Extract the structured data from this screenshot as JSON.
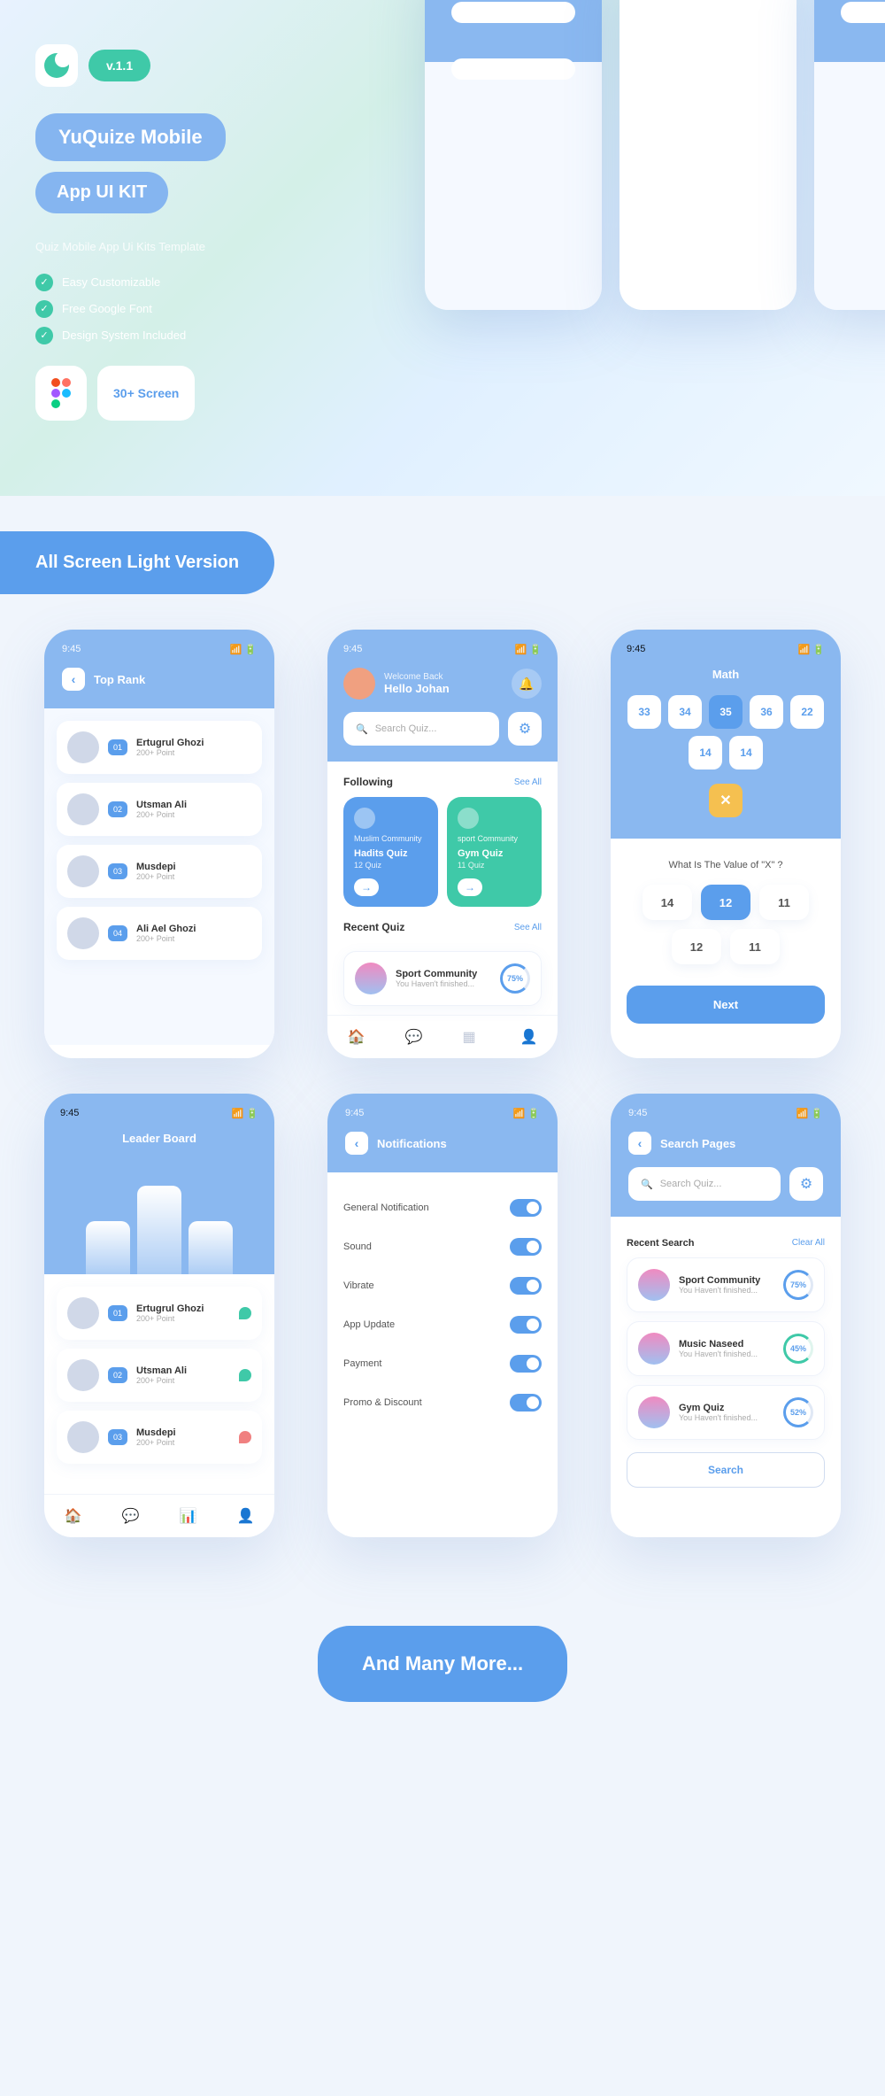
{
  "hero": {
    "version": "v.1.1",
    "title1": "YuQuize  Mobile",
    "title2": "App UI KIT",
    "subtitle": "Quiz  Mobile\nApp Ui Kits Template",
    "features": [
      "Easy Customizable",
      "Free Google Font",
      "Design System Included"
    ],
    "screen_count": "30+ Screen"
  },
  "section_light": "All Screen Light Version",
  "status_time": "9:45",
  "home": {
    "welcome": "Welcome Back",
    "name": "Hello Johan",
    "search_placeholder": "Search Quiz...",
    "following_title": "Following",
    "see_all": "See All",
    "cards": [
      {
        "community": "Muslim Community",
        "title": "Hadits Quiz",
        "sub": "12 Quiz"
      },
      {
        "community": "sport Community",
        "title": "Gym Quiz",
        "sub": "11 Quiz"
      }
    ],
    "recent_title": "Recent Quiz",
    "recent": {
      "title": "Sport Community",
      "sub": "You Haven't finished...",
      "pct": "75%"
    }
  },
  "top_rank": {
    "title": "Top Rank",
    "items": [
      {
        "num": "01",
        "name": "Ertugrul Ghozi",
        "pts": "200+ Point"
      },
      {
        "num": "02",
        "name": "Utsman Ali",
        "pts": "200+ Point"
      },
      {
        "num": "03",
        "name": "Musdepi",
        "pts": "200+ Point"
      },
      {
        "num": "04",
        "name": "Ali Ael Ghozi",
        "pts": "200+ Point"
      }
    ]
  },
  "math": {
    "title": "Math",
    "nums": [
      "33",
      "34",
      "35",
      "36",
      "22",
      "14",
      "14"
    ],
    "active_idx": 2,
    "question": "What Is The Value of \"X\" ?",
    "answers": [
      "14",
      "12",
      "11",
      "12",
      "11"
    ],
    "answer_active": 1,
    "next": "Next"
  },
  "leader": {
    "title": "Leader Board",
    "items": [
      {
        "num": "01",
        "name": "Ertugrul Ghozi",
        "pts": "200+ Point",
        "up": true
      },
      {
        "num": "02",
        "name": "Utsman Ali",
        "pts": "200+ Point",
        "up": true
      },
      {
        "num": "03",
        "name": "Musdepi",
        "pts": "200+ Point",
        "up": false
      }
    ]
  },
  "notifications": {
    "title": "Notifications",
    "items": [
      "General Notification",
      "Sound",
      "Vibrate",
      "App Update",
      "Payment",
      "Promo & Discount"
    ]
  },
  "search": {
    "title": "Search Pages",
    "placeholder": "Search Quiz...",
    "recent_title": "Recent Search",
    "clear": "Clear All",
    "items": [
      {
        "title": "Sport Community",
        "sub": "You Haven't finished...",
        "pct": "75%",
        "color": "blue"
      },
      {
        "title": "Music Naseed",
        "sub": "You Haven't finished...",
        "pct": "45%",
        "color": "green"
      },
      {
        "title": "Gym Quiz",
        "sub": "You Haven't finished...",
        "pct": "52%",
        "color": "blue"
      }
    ],
    "btn": "Search"
  },
  "footer": "And Many More..."
}
